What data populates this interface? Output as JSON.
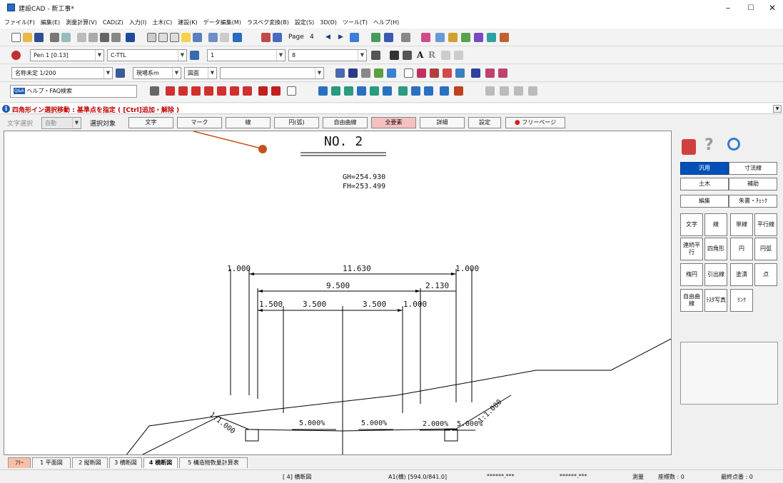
{
  "window": {
    "title": "建設CAD - 新工事*",
    "minimize": "–",
    "maximize": "☐",
    "close": "✕"
  },
  "menu": [
    "ファイル(F)",
    "編集(E)",
    "測量計算(V)",
    "CAD(Z)",
    "入力(I)",
    "土木(C)",
    "建設(K)",
    "データ編集(M)",
    "ラスベク変換(B)",
    "設定(S)",
    "3D(D)",
    "ツール(T)",
    "ヘルプ(H)"
  ],
  "toolbar1": {
    "page_label": "Page",
    "page_number": "4"
  },
  "toolbar2": {
    "pen": "Pen 1 [0.13]",
    "layer": "C-TTL",
    "line_type": "1",
    "line_weight": "8",
    "text_bold": "A",
    "text_r": "R"
  },
  "toolbar3": {
    "scale": "名称未定 1/200",
    "coord": "現場系m",
    "view": "図面",
    "blank": ""
  },
  "toolbar4": {
    "help_search": "ヘルプ・FAQ検索",
    "help_badge": "Q&A"
  },
  "status_message": "四角形イン選択移動 : 基準点を指定 ( [Ctrl]追加・解除 )",
  "filter": {
    "label": "文字選択",
    "mode": "自動",
    "target_label": "選択対象",
    "buttons": [
      "文字",
      "マーク",
      "線",
      "円(弧)",
      "自由曲線",
      "全要素",
      "詳細",
      "設定"
    ],
    "freepage": "フリーページ"
  },
  "drawing": {
    "title": "NO. 2",
    "gh": "GH=254.930",
    "fh": "FH=253.499",
    "dims": {
      "left_1000": "1.000",
      "total": "11.630",
      "right_1000": "1.000",
      "w9500": "9.500",
      "w2130": "2.130",
      "w1500": "1.500",
      "w3500a": "3.500",
      "w3500b": "3.500",
      "w1000b": "1.000"
    },
    "slopes": {
      "left": "1:1.000",
      "right": "1:1.000"
    },
    "grades": {
      "g1": "5.000%",
      "g2": "5.000%",
      "g3": "2.000%",
      "g4": "5.000%"
    }
  },
  "panel": {
    "tabs_top": [
      "汎用",
      "寸法線"
    ],
    "tabs_mid": [
      "土木",
      "補助"
    ],
    "tabs_low": [
      "編集",
      "朱書・ﾁｪｯｸ"
    ],
    "tools": [
      [
        "文字",
        "線",
        "単線",
        "平行線"
      ],
      [
        "連続平行",
        "四角形",
        "円",
        "円弧"
      ],
      [
        "楕円",
        "引出線",
        "塗潰",
        "点"
      ],
      [
        "自由曲線",
        "ﾗｽﾀ写真",
        "ﾘﾝｸ"
      ]
    ]
  },
  "sheet_tabs": [
    "ﾌﾘｰ",
    "1 平面図",
    "2 縦断図",
    "3 横断図",
    "4 横断図",
    "5 構造物数量計算表"
  ],
  "statusbar": {
    "sheet": "[ 4] 横断図",
    "paper": "A1(横) [594.0/841.0]",
    "x": "******.***",
    "y": "******.***",
    "mode": "測量",
    "count": "座標数 : 0",
    "last": "最終点番 : 0"
  },
  "colors": {
    "accent": "#0050b8",
    "message": "#c00000",
    "annotation": "#c0541c",
    "freepage_tab": "#f6c0a8"
  }
}
